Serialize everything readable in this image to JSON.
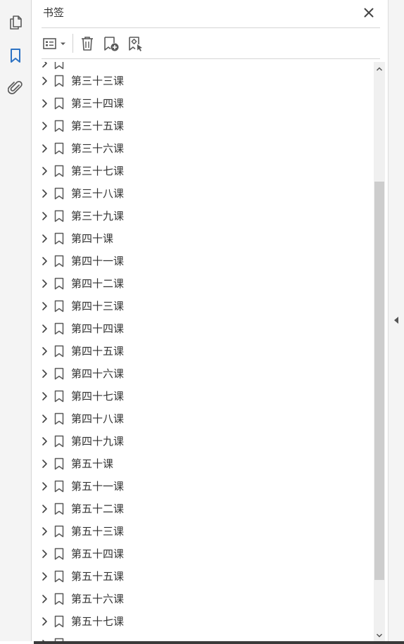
{
  "panel": {
    "title": "书签"
  },
  "rail": {
    "items": [
      {
        "icon": "pages-icon",
        "active": false
      },
      {
        "icon": "bookmark-icon",
        "active": true
      },
      {
        "icon": "attachment-icon",
        "active": false
      }
    ]
  },
  "toolbar": {
    "items": [
      "options-menu-icon",
      "delete-icon",
      "new-bookmark-icon",
      "bookmark-from-selection-icon"
    ]
  },
  "bookmarks": [
    "第三十三课",
    "第三十四课",
    "第三十五课",
    "第三十六课",
    "第三十七课",
    "第三十八课",
    "第三十九课",
    "第四十课",
    "第四十一课",
    "第四十二课",
    "第四十三课",
    "第四十四课",
    "第四十五课",
    "第四十六课",
    "第四十七课",
    "第四十八课",
    "第四十九课",
    "第五十课",
    "第五十一课",
    "第五十二课",
    "第五十三课",
    "第五十四课",
    "第五十五课",
    "第五十六课",
    "第五十七课"
  ],
  "colors": {
    "accent": "#2d73c4",
    "icon": "#5a5a5a",
    "text": "#333333"
  }
}
